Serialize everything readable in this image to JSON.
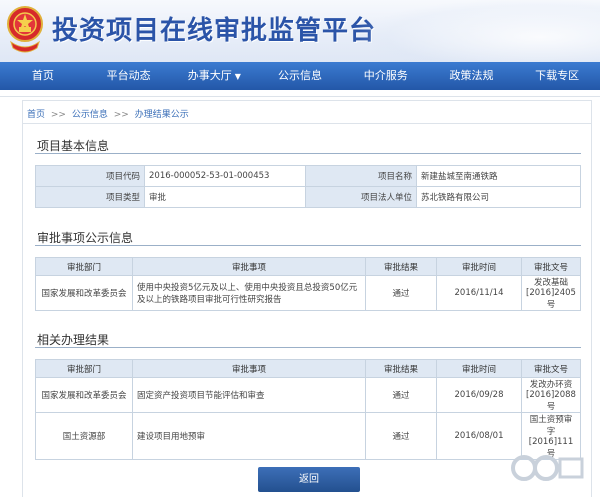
{
  "header": {
    "title": "投资项目在线审批监管平台"
  },
  "nav": [
    {
      "label": "首页"
    },
    {
      "label": "平台动态"
    },
    {
      "label": "办事大厅",
      "caret": "▼"
    },
    {
      "label": "公示信息"
    },
    {
      "label": "中介服务"
    },
    {
      "label": "政策法规"
    },
    {
      "label": "下载专区"
    }
  ],
  "breadcrumb": {
    "home": "首页",
    "sep": ">>",
    "level2": "公示信息",
    "level3": "办理结果公示"
  },
  "basic_info": {
    "title": "项目基本信息",
    "code_label": "项目代码",
    "code_value": "2016-000052-53-01-000453",
    "name_label": "项目名称",
    "name_value": "新建盐城至南通铁路",
    "type_label": "项目类型",
    "type_value": "审批",
    "owner_label": "项目法人单位",
    "owner_value": "苏北铁路有限公司"
  },
  "approval_public": {
    "title": "审批事项公示信息",
    "headers": [
      "审批部门",
      "审批事项",
      "审批结果",
      "审批时间",
      "审批文号"
    ],
    "rows": [
      {
        "dept": "国家发展和改革委员会",
        "item_line1": "使用中央投资5亿元及以上、使用中央投资且总投资50亿元",
        "item_line2": "及以上的铁路项目审批可行性研究报告",
        "result": "通过",
        "date": "2016/11/14",
        "doc_line1": "发改基础",
        "doc_line2": "[2016]2405号"
      }
    ]
  },
  "related_results": {
    "title": "相关办理结果",
    "headers": [
      "审批部门",
      "审批事项",
      "审批结果",
      "审批时间",
      "审批文号"
    ],
    "rows": [
      {
        "dept": "国家发展和改革委员会",
        "item": "固定资产投资项目节能评估和审查",
        "result": "通过",
        "date": "2016/09/28",
        "doc_line1": "发改办环资",
        "doc_line2": "[2016]2088号"
      },
      {
        "dept": "国土资源部",
        "item": "建设项目用地预审",
        "result": "通过",
        "date": "2016/08/01",
        "doc_line1": "国土资预审字",
        "doc_line2": "[2016]111号"
      }
    ]
  },
  "back_button": {
    "label": "返回"
  },
  "colors": {
    "brand": "#2b54a8",
    "nav": "#2357a8",
    "header_cell": "#dfe8f3",
    "border": "#c7d3e0"
  }
}
